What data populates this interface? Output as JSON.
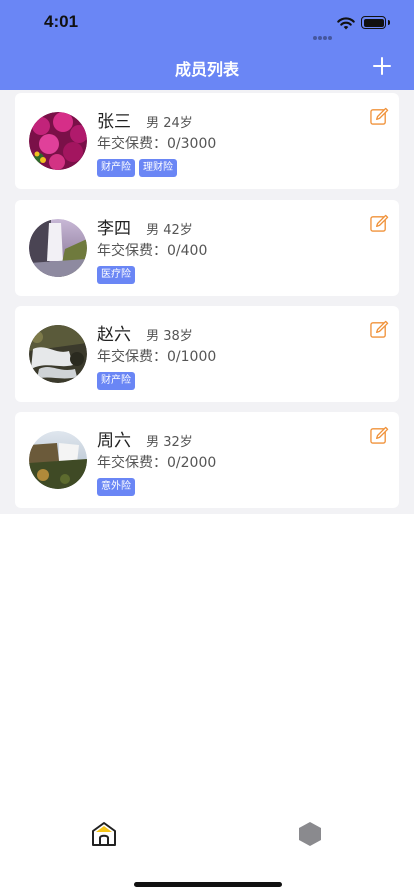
{
  "status_bar": {
    "time": "4:01"
  },
  "header": {
    "title": "成员列表",
    "add_icon": "plus-icon"
  },
  "colors": {
    "accent": "#6a86f5",
    "edit_icon": "#f0923a",
    "list_background": "#f2f2f5"
  },
  "members": [
    {
      "name": "张三",
      "gender": "男",
      "age": "24岁",
      "fee_label": "年交保费：",
      "fee": "0/3000",
      "tags": [
        "财产险",
        "理财险"
      ],
      "avatar": "purple-flowers-photo"
    },
    {
      "name": "李四",
      "gender": "男",
      "age": "42岁",
      "fee_label": "年交保费：",
      "fee": "0/400",
      "tags": [
        "医疗险"
      ],
      "avatar": "waterfall-photo"
    },
    {
      "name": "赵六",
      "gender": "男",
      "age": "38岁",
      "fee_label": "年交保费：",
      "fee": "0/1000",
      "tags": [
        "财产险"
      ],
      "avatar": "rapids-photo"
    },
    {
      "name": "周六",
      "gender": "男",
      "age": "32岁",
      "fee_label": "年交保费：",
      "fee": "0/2000",
      "tags": [
        "意外险"
      ],
      "avatar": "cliff-waterfall-photo"
    }
  ],
  "tab_bar": {
    "home_icon": "home-icon",
    "second_icon": "hexagon-icon"
  }
}
